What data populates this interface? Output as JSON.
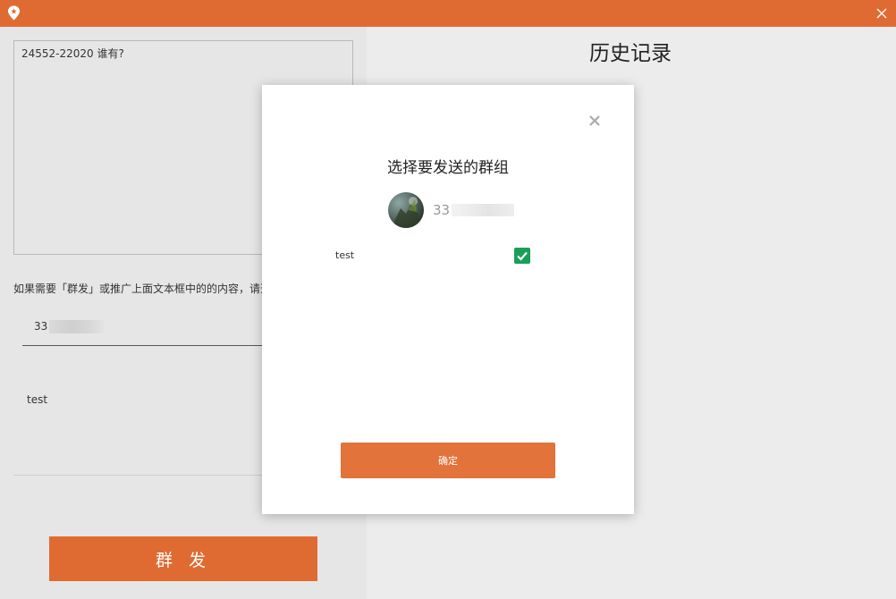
{
  "window": {
    "accent_color": "#df6b33",
    "app_icon": "location-pin-icon",
    "close_icon": "close-icon"
  },
  "left": {
    "message_text": "24552-22020 谁有?",
    "hint": "如果需要「群发」或推广上面文本框中的的内容，请选",
    "account_prefix": "33",
    "group_name": "test",
    "send_label": "群 发"
  },
  "right": {
    "title": "历史记录"
  },
  "dialog": {
    "title": "选择要发送的群组",
    "account_prefix": "33",
    "group_name": "test",
    "checked": true,
    "confirm_label": "确定",
    "check_color": "#18a058"
  }
}
